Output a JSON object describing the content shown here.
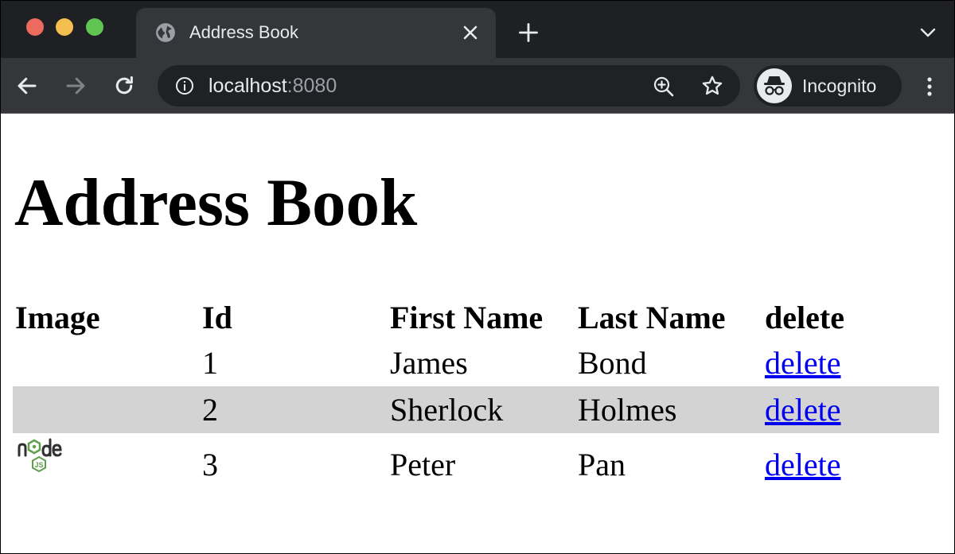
{
  "browser": {
    "tab_title": "Address Book",
    "url_host": "localhost",
    "url_port": ":8080",
    "profile_label": "Incognito",
    "icons": {
      "favicon": "globe-icon",
      "close": "close-icon",
      "new_tab": "plus-icon",
      "tab_search": "chevron-down-icon",
      "back": "back-arrow-icon",
      "forward": "forward-arrow-icon",
      "reload": "reload-icon",
      "site_info": "info-icon",
      "zoom": "zoom-in-icon",
      "bookmark": "star-icon",
      "incognito": "incognito-icon",
      "menu": "kebab-menu-icon"
    }
  },
  "page": {
    "heading": "Address Book",
    "table": {
      "headers": [
        "Image",
        "Id",
        "First Name",
        "Last Name",
        "delete"
      ],
      "rows": [
        {
          "image": "",
          "id": "1",
          "first_name": "James",
          "last_name": "Bond",
          "action": "delete"
        },
        {
          "image": "",
          "id": "2",
          "first_name": "Sherlock",
          "last_name": "Holmes",
          "action": "delete"
        },
        {
          "image": "node-js-logo",
          "id": "3",
          "first_name": "Peter",
          "last_name": "Pan",
          "action": "delete"
        }
      ]
    },
    "colors": {
      "link": "#0000ee",
      "row_highlight": "#d3d3d3",
      "node_green": "#5fa04e"
    }
  }
}
